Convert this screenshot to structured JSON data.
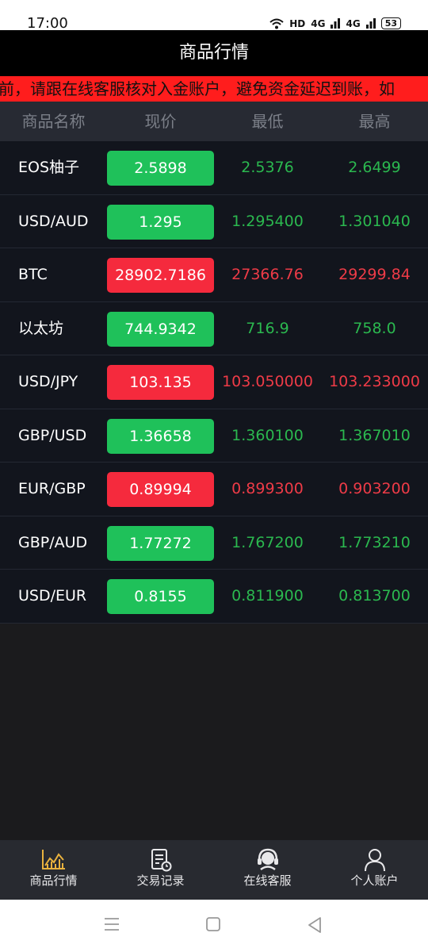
{
  "status_bar": {
    "time": "17:00",
    "network_label": "HD",
    "signal1": "4G",
    "signal2": "4G",
    "battery": "53"
  },
  "header": {
    "title": "商品行情"
  },
  "notice": {
    "text": "金前，请跟在线客服核对入金账户，避免资金延迟到账，如"
  },
  "table": {
    "columns": [
      "商品名称",
      "现价",
      "最低",
      "最高"
    ],
    "rows": [
      {
        "name": "EOS柚子",
        "price": "2.5898",
        "low": "2.5376",
        "high": "2.6499",
        "trend": "up"
      },
      {
        "name": "USD/AUD",
        "price": "1.295",
        "low": "1.295400",
        "high": "1.301040",
        "trend": "up"
      },
      {
        "name": "BTC",
        "price": "28902.7186",
        "low": "27366.76",
        "high": "29299.84",
        "trend": "down"
      },
      {
        "name": "以太坊",
        "price": "744.9342",
        "low": "716.9",
        "high": "758.0",
        "trend": "up"
      },
      {
        "name": "USD/JPY",
        "price": "103.135",
        "low": "103.050000",
        "high": "103.233000",
        "trend": "down"
      },
      {
        "name": "GBP/USD",
        "price": "1.36658",
        "low": "1.360100",
        "high": "1.367010",
        "trend": "up"
      },
      {
        "name": "EUR/GBP",
        "price": "0.89994",
        "low": "0.899300",
        "high": "0.903200",
        "trend": "down"
      },
      {
        "name": "GBP/AUD",
        "price": "1.77272",
        "low": "1.767200",
        "high": "1.773210",
        "trend": "up"
      },
      {
        "name": "USD/EUR",
        "price": "0.8155",
        "low": "0.811900",
        "high": "0.813700",
        "trend": "up"
      }
    ]
  },
  "colors": {
    "up_bg": "#1fc15a",
    "up_text": "#2bb84f",
    "down_bg": "#f52a3d",
    "down_text": "#ee3b47",
    "accent": "#e9b23e",
    "notice_bg": "#ff1d1d"
  },
  "bottom_nav": {
    "items": [
      {
        "label": "商品行情",
        "icon": "chart-icon",
        "active": true
      },
      {
        "label": "交易记录",
        "icon": "record-icon",
        "active": false
      },
      {
        "label": "在线客服",
        "icon": "headset-icon",
        "active": false
      },
      {
        "label": "个人账户",
        "icon": "user-icon",
        "active": false
      }
    ]
  }
}
